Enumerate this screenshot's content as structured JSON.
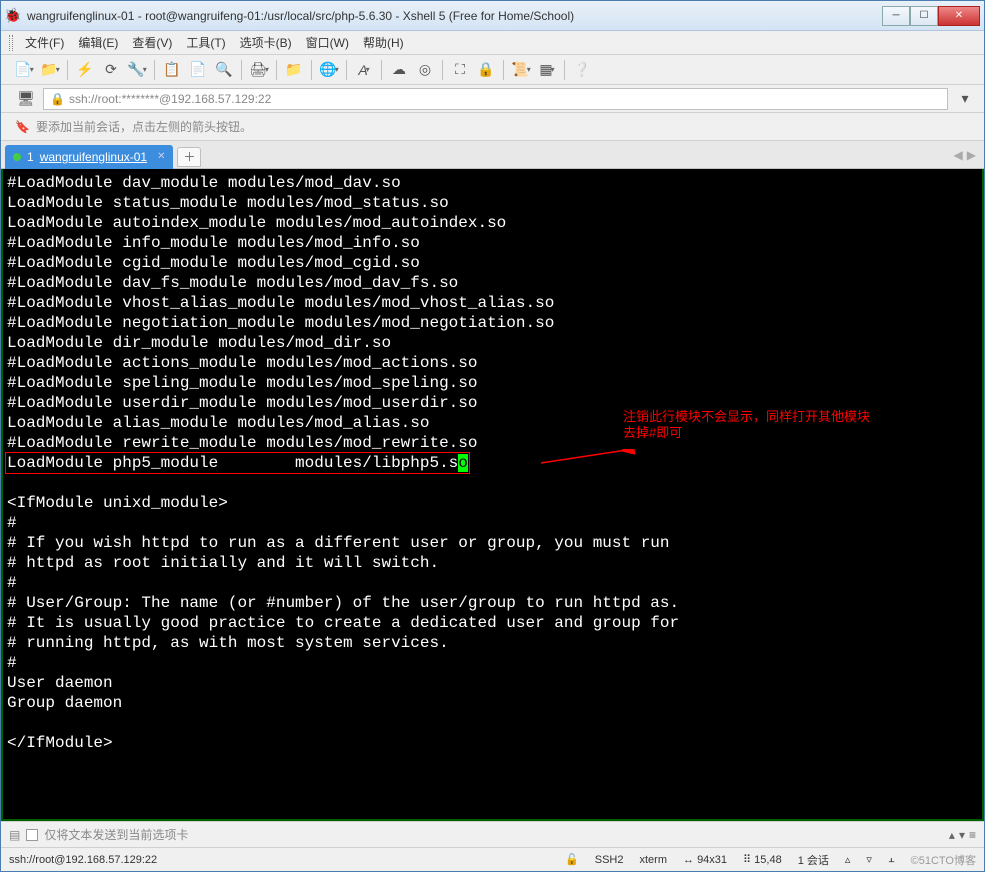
{
  "window": {
    "title": "wangruifenglinux-01 - root@wangruifeng-01:/usr/local/src/php-5.6.30 - Xshell 5 (Free for Home/School)"
  },
  "menu": {
    "file": "文件(F)",
    "edit": "编辑(E)",
    "view": "查看(V)",
    "tools": "工具(T)",
    "tabs": "选项卡(B)",
    "window": "窗口(W)",
    "help": "帮助(H)"
  },
  "address": {
    "url": "ssh://root:********@192.168.57.129:22"
  },
  "infobar": {
    "hint": "要添加当前会话，点击左侧的箭头按钮。"
  },
  "tab": {
    "index": "1",
    "label": "wangruifenglinux-01"
  },
  "terminal_lines": [
    "#LoadModule dav_module modules/mod_dav.so",
    "LoadModule status_module modules/mod_status.so",
    "LoadModule autoindex_module modules/mod_autoindex.so",
    "#LoadModule info_module modules/mod_info.so",
    "#LoadModule cgid_module modules/mod_cgid.so",
    "#LoadModule dav_fs_module modules/mod_dav_fs.so",
    "#LoadModule vhost_alias_module modules/mod_vhost_alias.so",
    "#LoadModule negotiation_module modules/mod_negotiation.so",
    "LoadModule dir_module modules/mod_dir.so",
    "#LoadModule actions_module modules/mod_actions.so",
    "#LoadModule speling_module modules/mod_speling.so",
    "#LoadModule userdir_module modules/mod_userdir.so",
    "LoadModule alias_module modules/mod_alias.so",
    "#LoadModule rewrite_module modules/mod_rewrite.so"
  ],
  "highlighted_line": {
    "prefix": "LoadModule php5_module        modules/libphp5.s",
    "cursor_char": "o"
  },
  "terminal_lines2": [
    "",
    "<IfModule unixd_module>",
    "#",
    "# If you wish httpd to run as a different user or group, you must run",
    "# httpd as root initially and it will switch.",
    "#",
    "# User/Group: The name (or #number) of the user/group to run httpd as.",
    "# It is usually good practice to create a dedicated user and group for",
    "# running httpd, as with most system services.",
    "#",
    "User daemon",
    "Group daemon",
    "",
    "</IfModule>"
  ],
  "annotation": {
    "text": "注销此行模块不会显示，同样打开其他模块\n去掉#即可"
  },
  "sendbar": {
    "label": "仅将文本发送到当前选项卡"
  },
  "status": {
    "conn": "ssh://root@192.168.57.129:22",
    "proto": "SSH2",
    "term": "xterm",
    "size": "94x31",
    "pos": "15,48",
    "session": "1 会话",
    "watermark": "©51CTO博客"
  }
}
